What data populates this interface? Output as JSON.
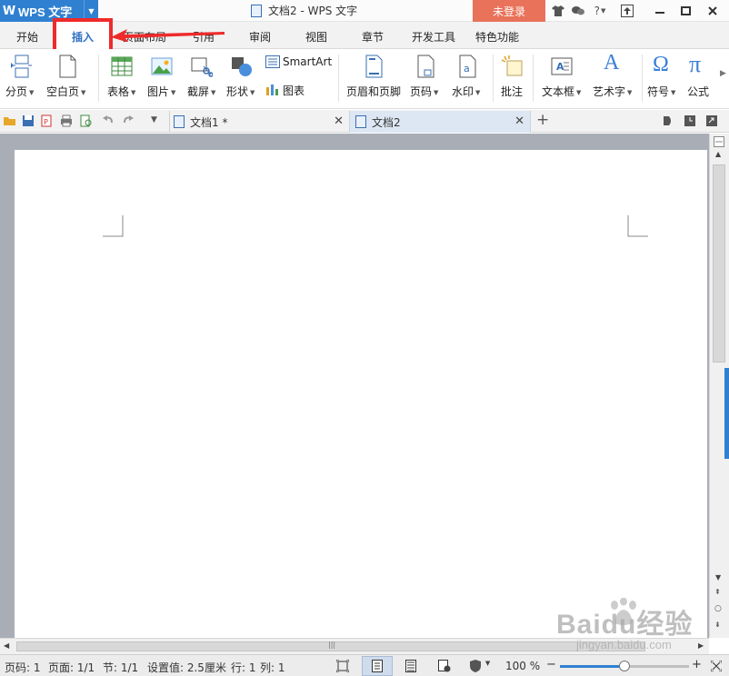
{
  "titlebar": {
    "app_name": "WPS 文字",
    "app_logo": "W",
    "document_title": "文档2 - WPS 文字",
    "login_label": "未登录",
    "icons": [
      "shirt-icon",
      "chat-icon",
      "help-icon",
      "collapse-icon",
      "upload-icon",
      "minimize-icon",
      "maximize-icon",
      "close-icon"
    ]
  },
  "menu": {
    "tabs": [
      "开始",
      "插入",
      "页面布局",
      "引用",
      "审阅",
      "视图",
      "章节",
      "开发工具",
      "特色功能"
    ],
    "active_tab": "插入"
  },
  "ribbon": {
    "page_break": "分页",
    "blank_page": "空白页",
    "table": "表格",
    "picture": "图片",
    "screenshot": "截屏",
    "shape": "形状",
    "smartart": "SmartArt",
    "chart": "图表",
    "header_footer": "页眉和页脚",
    "page_number": "页码",
    "watermark": "水印",
    "comment": "批注",
    "textbox": "文本框",
    "wordart": "艺术字",
    "symbol": "符号",
    "formula": "公式",
    "symbol_glyph": "Ω",
    "formula_glyph": "π",
    "wordart_glyph": "A"
  },
  "doc_tabs": [
    {
      "label": "文档1 *"
    },
    {
      "label": "文档2"
    }
  ],
  "statusbar": {
    "page_code": "页码: 1",
    "pages": "页面: 1/1",
    "section": "节: 1/1",
    "setting": "设置值: 2.5厘米",
    "row": "行: 1",
    "col": "列: 1",
    "zoom": "100 %",
    "zoom_minus": "−",
    "zoom_plus": "+",
    "zoom_level": 0.5
  },
  "watermark": {
    "brand": "Baidu经验",
    "url": "jingyan.baidu.com"
  },
  "colors": {
    "accent": "#2f80d1",
    "login": "#e9725a",
    "highlight": "#ee2a2a"
  }
}
